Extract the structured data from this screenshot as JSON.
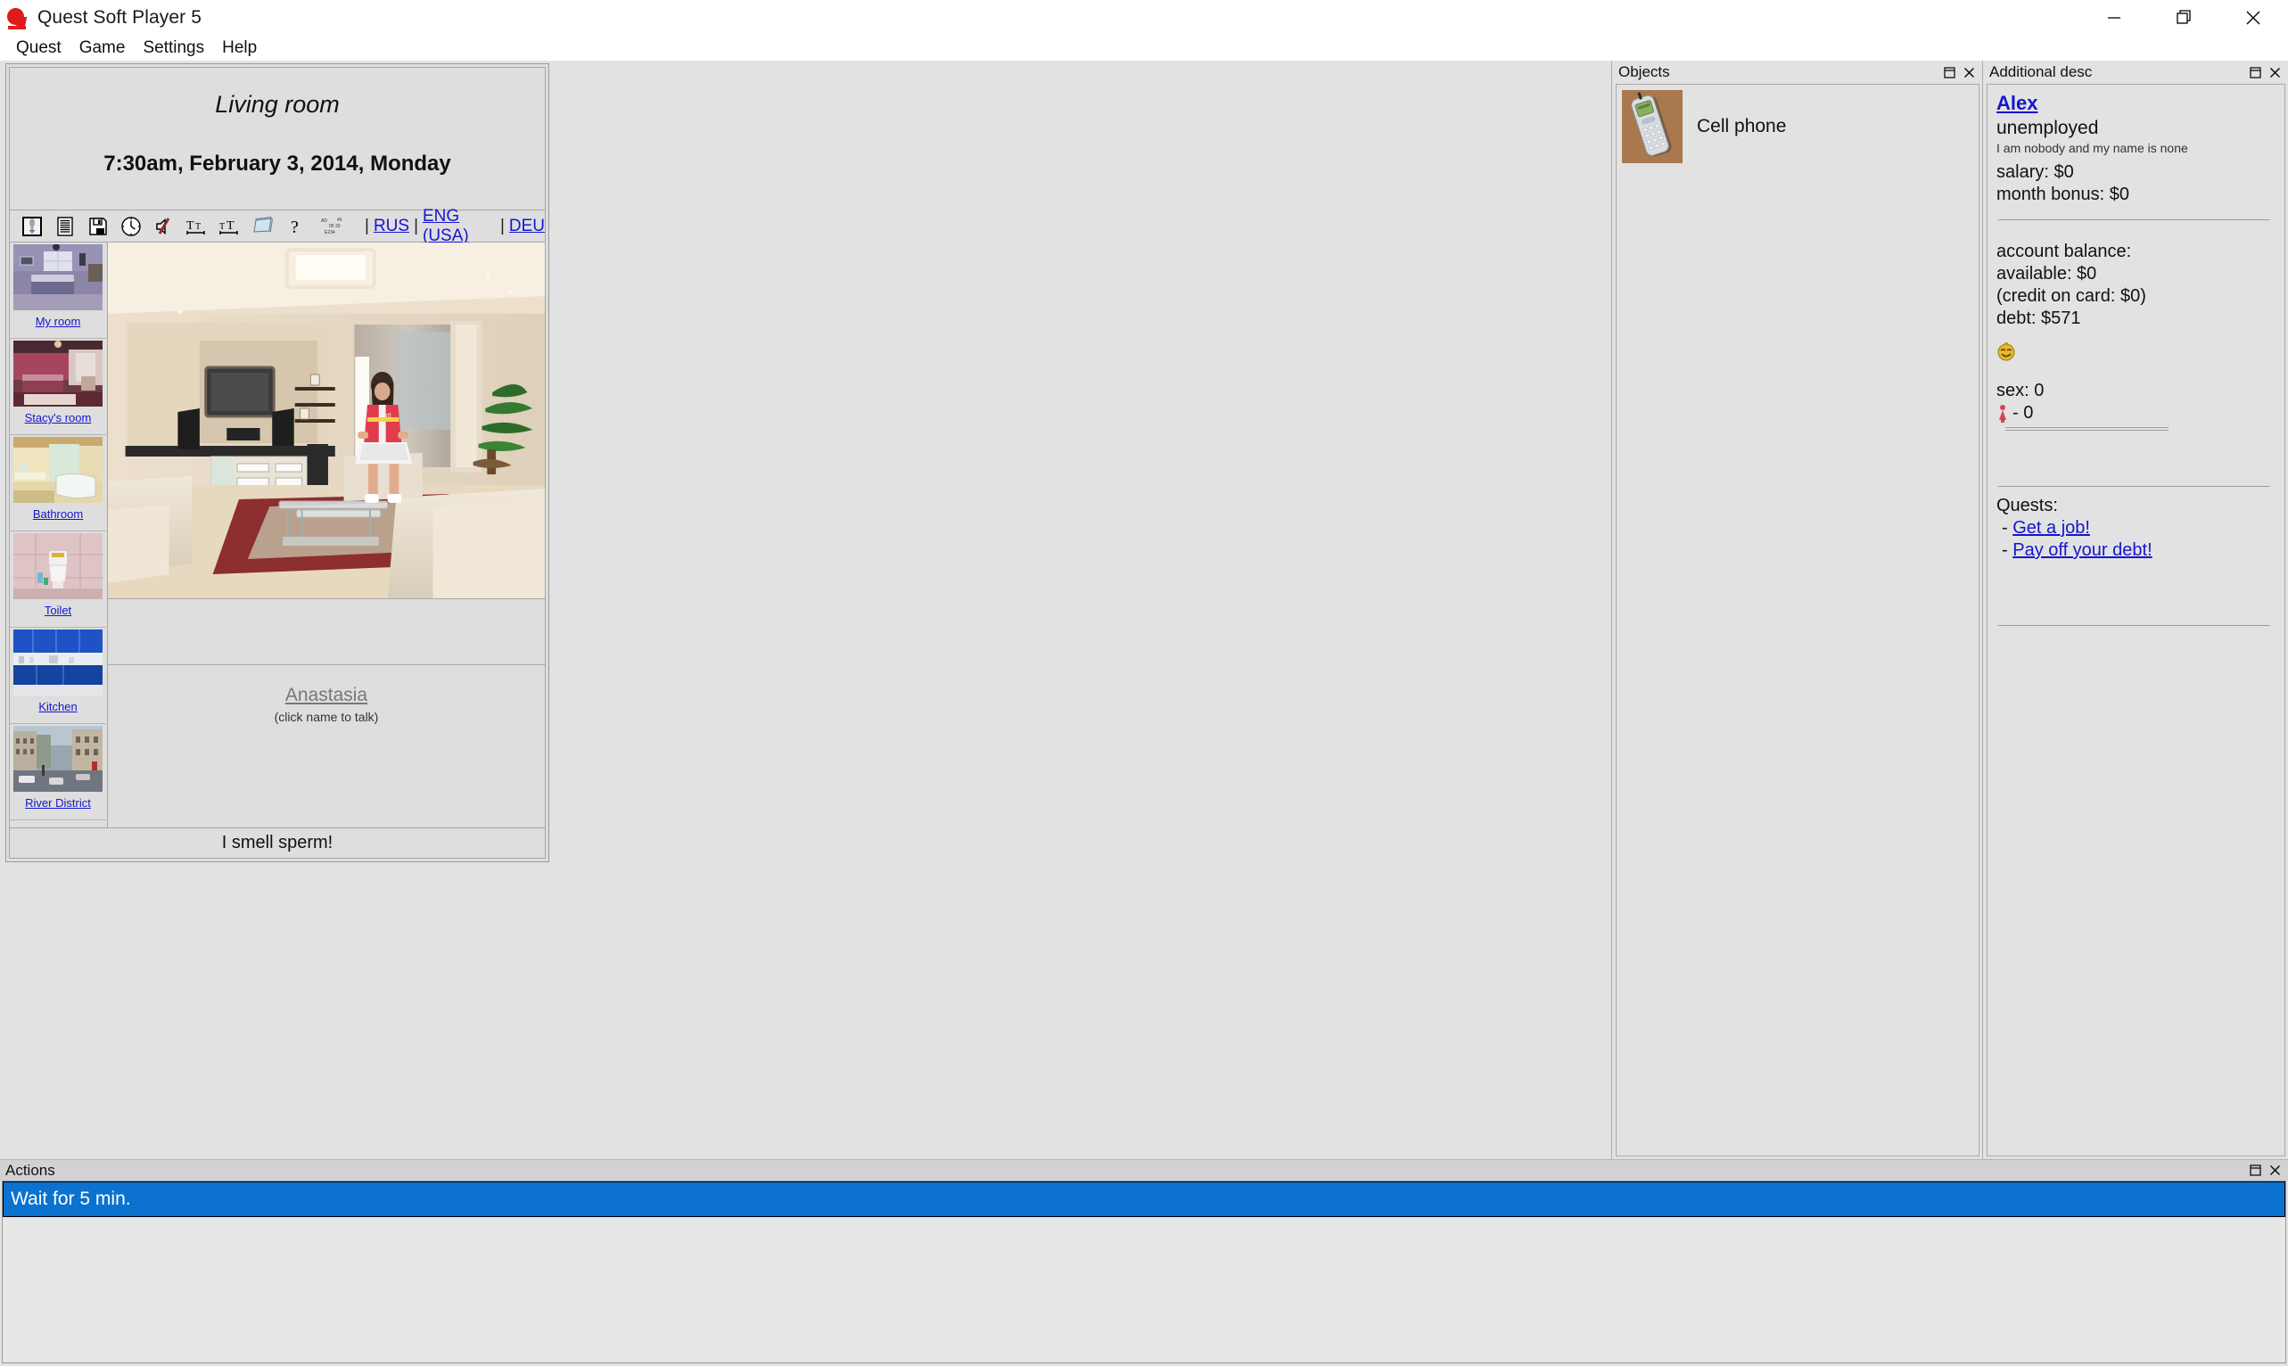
{
  "window": {
    "title": "Quest Soft Player 5",
    "app_icon": "quest-logo-icon",
    "minimize": "minimize-icon",
    "maximize": "maximize-icon",
    "close": "close-icon"
  },
  "menu": {
    "items": [
      "Quest",
      "Game",
      "Settings",
      "Help"
    ]
  },
  "game": {
    "room_title": "Living room",
    "datetime": "7:30am, February 3, 2014, Monday",
    "toolbar": {
      "icons": [
        "inventory-icon",
        "text-lines-icon",
        "save-floppy-icon",
        "clock-icon",
        "mute-sound-icon",
        "decrease-font-icon",
        "increase-font-icon",
        "notepad-icon",
        "help-question-icon",
        "timestamp-icon"
      ],
      "separator": "|",
      "languages": [
        "RUS",
        "ENG (USA)",
        "DEU"
      ],
      "lang_pipe": "|"
    },
    "locations": [
      {
        "label": "My room",
        "thumb": "bedroom-purple-thumb"
      },
      {
        "label": "Stacy's room",
        "thumb": "bedroom-pink-thumb"
      },
      {
        "label": "Bathroom",
        "thumb": "bathroom-thumb"
      },
      {
        "label": "Toilet",
        "thumb": "toilet-thumb"
      },
      {
        "label": "Kitchen",
        "thumb": "kitchen-blue-thumb"
      },
      {
        "label": "River District",
        "thumb": "street-thumb"
      }
    ],
    "scene": "living-room-scene",
    "npc": {
      "name": "Anastasia",
      "hint": "(click name to talk)"
    },
    "status_text": "I smell sperm!"
  },
  "objects_panel": {
    "title": "Objects",
    "restore": "restore-icon",
    "close": "close-icon",
    "items": [
      {
        "label": "Cell phone",
        "thumb": "cell-phone-thumb"
      }
    ]
  },
  "additional_desc": {
    "title": "Additional desc",
    "restore": "restore-icon",
    "close": "close-icon",
    "character_name": "Alex",
    "job": "unemployed",
    "motto": "I am nobody and my name is none",
    "salary": "salary: $0",
    "month_bonus": "month bonus: $0",
    "account_balance_label": "account balance:",
    "available": " available: $0",
    "credit_on_card": "(credit on card: $0)",
    "debt": "debt: $571",
    "mood_icon": "smiley-icon",
    "sex_label": "sex:  0",
    "gender_icon": "female-figure-icon",
    "gender_value": "- 0",
    "quests_label": "Quests:",
    "quests": [
      "Get a job!",
      "Pay off your debt!"
    ],
    "quest_bullet": "-"
  },
  "actions_panel": {
    "title": "Actions",
    "restore": "restore-icon",
    "close": "close-icon",
    "items": [
      "Wait for 5 min."
    ],
    "selected_index": 0
  },
  "colors": {
    "link": "#1515cf",
    "selection": "#0b72d0",
    "panel_bg": "#e2e2e2",
    "logo_red": "#e01b1b"
  }
}
